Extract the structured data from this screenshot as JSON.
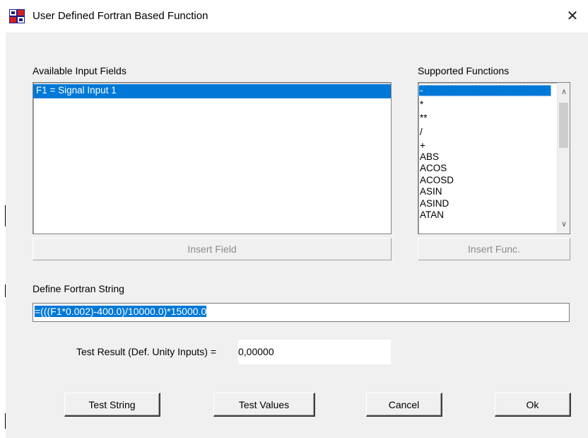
{
  "window": {
    "title": "User Defined Fortran Based Function",
    "close_glyph": "✕",
    "icon": "app-logo-icon"
  },
  "input_fields": {
    "label": "Available Input Fields",
    "items": [
      "F1 = Signal Input 1"
    ],
    "insert_button": "Insert Field"
  },
  "functions": {
    "label": "Supported Functions",
    "items": [
      "-",
      "*",
      "**",
      "/",
      "+",
      "ABS",
      "ACOS",
      "ACOSD",
      "ASIN",
      "ASIND",
      "ATAN"
    ],
    "insert_button": "Insert Func.",
    "scroll_up_glyph": "∧",
    "scroll_down_glyph": "∨"
  },
  "fortran": {
    "label": "Define Fortran String",
    "value": "=(((F1*0.002)-400.0)/10000.0)*15000.0"
  },
  "test_result": {
    "label": "Test Result (Def. Unity Inputs) =",
    "value": "0,00000"
  },
  "buttons": {
    "test_string": "Test String",
    "test_values": "Test Values",
    "cancel": "Cancel",
    "ok": "Ok"
  },
  "colors": {
    "selection": "#0078d7",
    "client_bg": "#f0f0f0"
  }
}
